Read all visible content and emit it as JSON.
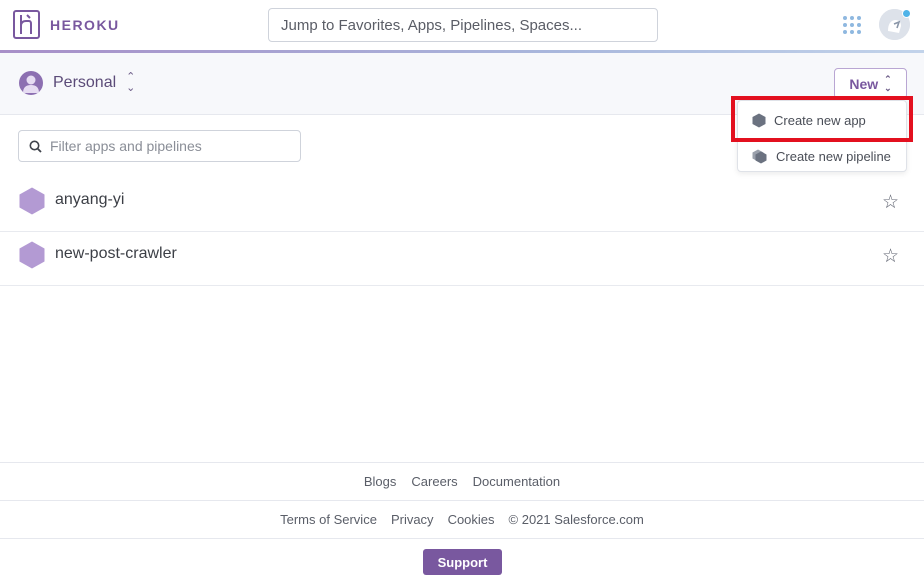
{
  "header": {
    "brand": "HEROKU",
    "search_placeholder": "Jump to Favorites, Apps, Pipelines, Spaces..."
  },
  "subheader": {
    "account_label": "Personal",
    "new_button_label": "New"
  },
  "dropdown": {
    "items": [
      {
        "label": "Create new app",
        "icon": "hexagon-icon"
      },
      {
        "label": "Create new pipeline",
        "icon": "pipeline-icon"
      }
    ]
  },
  "filter": {
    "placeholder": "Filter apps and pipelines"
  },
  "apps": [
    {
      "name": "anyang-yi"
    },
    {
      "name": "new-post-crawler"
    }
  ],
  "footer": {
    "links_row1": [
      "Blogs",
      "Careers",
      "Documentation"
    ],
    "links_row2": [
      "Terms of Service",
      "Privacy",
      "Cookies"
    ],
    "copyright": "© 2021 Salesforce.com",
    "support_label": "Support"
  },
  "colors": {
    "brand_purple": "#79589f",
    "highlight_red": "#e3101f",
    "app_hex": "#b39ad3"
  }
}
